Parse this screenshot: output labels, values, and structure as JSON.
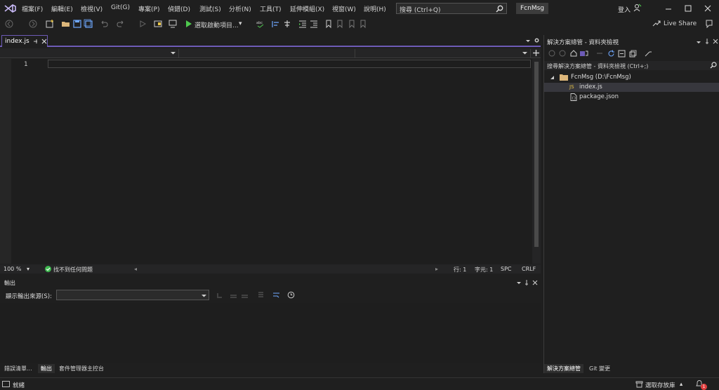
{
  "menu": {
    "items": [
      "檔案(F)",
      "編輯(E)",
      "檢視(V)",
      "Git(G)",
      "專案(P)",
      "偵錯(D)",
      "測試(S)",
      "分析(N)",
      "工具(T)",
      "延伸模組(X)",
      "視窗(W)",
      "說明(H)"
    ]
  },
  "search": {
    "placeholder": "搜尋 (Ctrl+Q)"
  },
  "solution_name": "FcnMsg",
  "sign_in": "登入",
  "toolbar": {
    "start_label": "選取啟動項目...",
    "live_share": "Live Share"
  },
  "editor": {
    "tab_label": "index.js",
    "line_number": "1",
    "zoom": "100 %",
    "issues": "找不到任何問題",
    "line": "行: 1",
    "col": "字元: 1",
    "spc": "SPC",
    "crlf": "CRLF"
  },
  "output": {
    "title": "輸出",
    "source_label": "顯示輸出來源(S):"
  },
  "bottom_tabs": [
    "錯誤清單...",
    "輸出",
    "套件管理器主控台"
  ],
  "solution_explorer": {
    "title": "解決方案總管 - 資料夾檢視",
    "search_placeholder": "搜尋解決方案總管 - 資料夾檢視 (Ctrl+;)",
    "root": "FcnMsg (D:\\FcnMsg)",
    "files": [
      "index.js",
      "package.json"
    ],
    "file_icon_js": "JS",
    "tabs": [
      "解決方案總管",
      "Git 變更"
    ]
  },
  "status": {
    "ready": "就緒",
    "repo": "選取存放庫",
    "notifications": "1"
  },
  "colors": {
    "accent": "#6d5bb6",
    "run_green": "#4ec94e",
    "ok_green": "#3fb950",
    "folder": "#dcb67a",
    "js": "#e8c547",
    "badge_red": "#e03e3e"
  }
}
